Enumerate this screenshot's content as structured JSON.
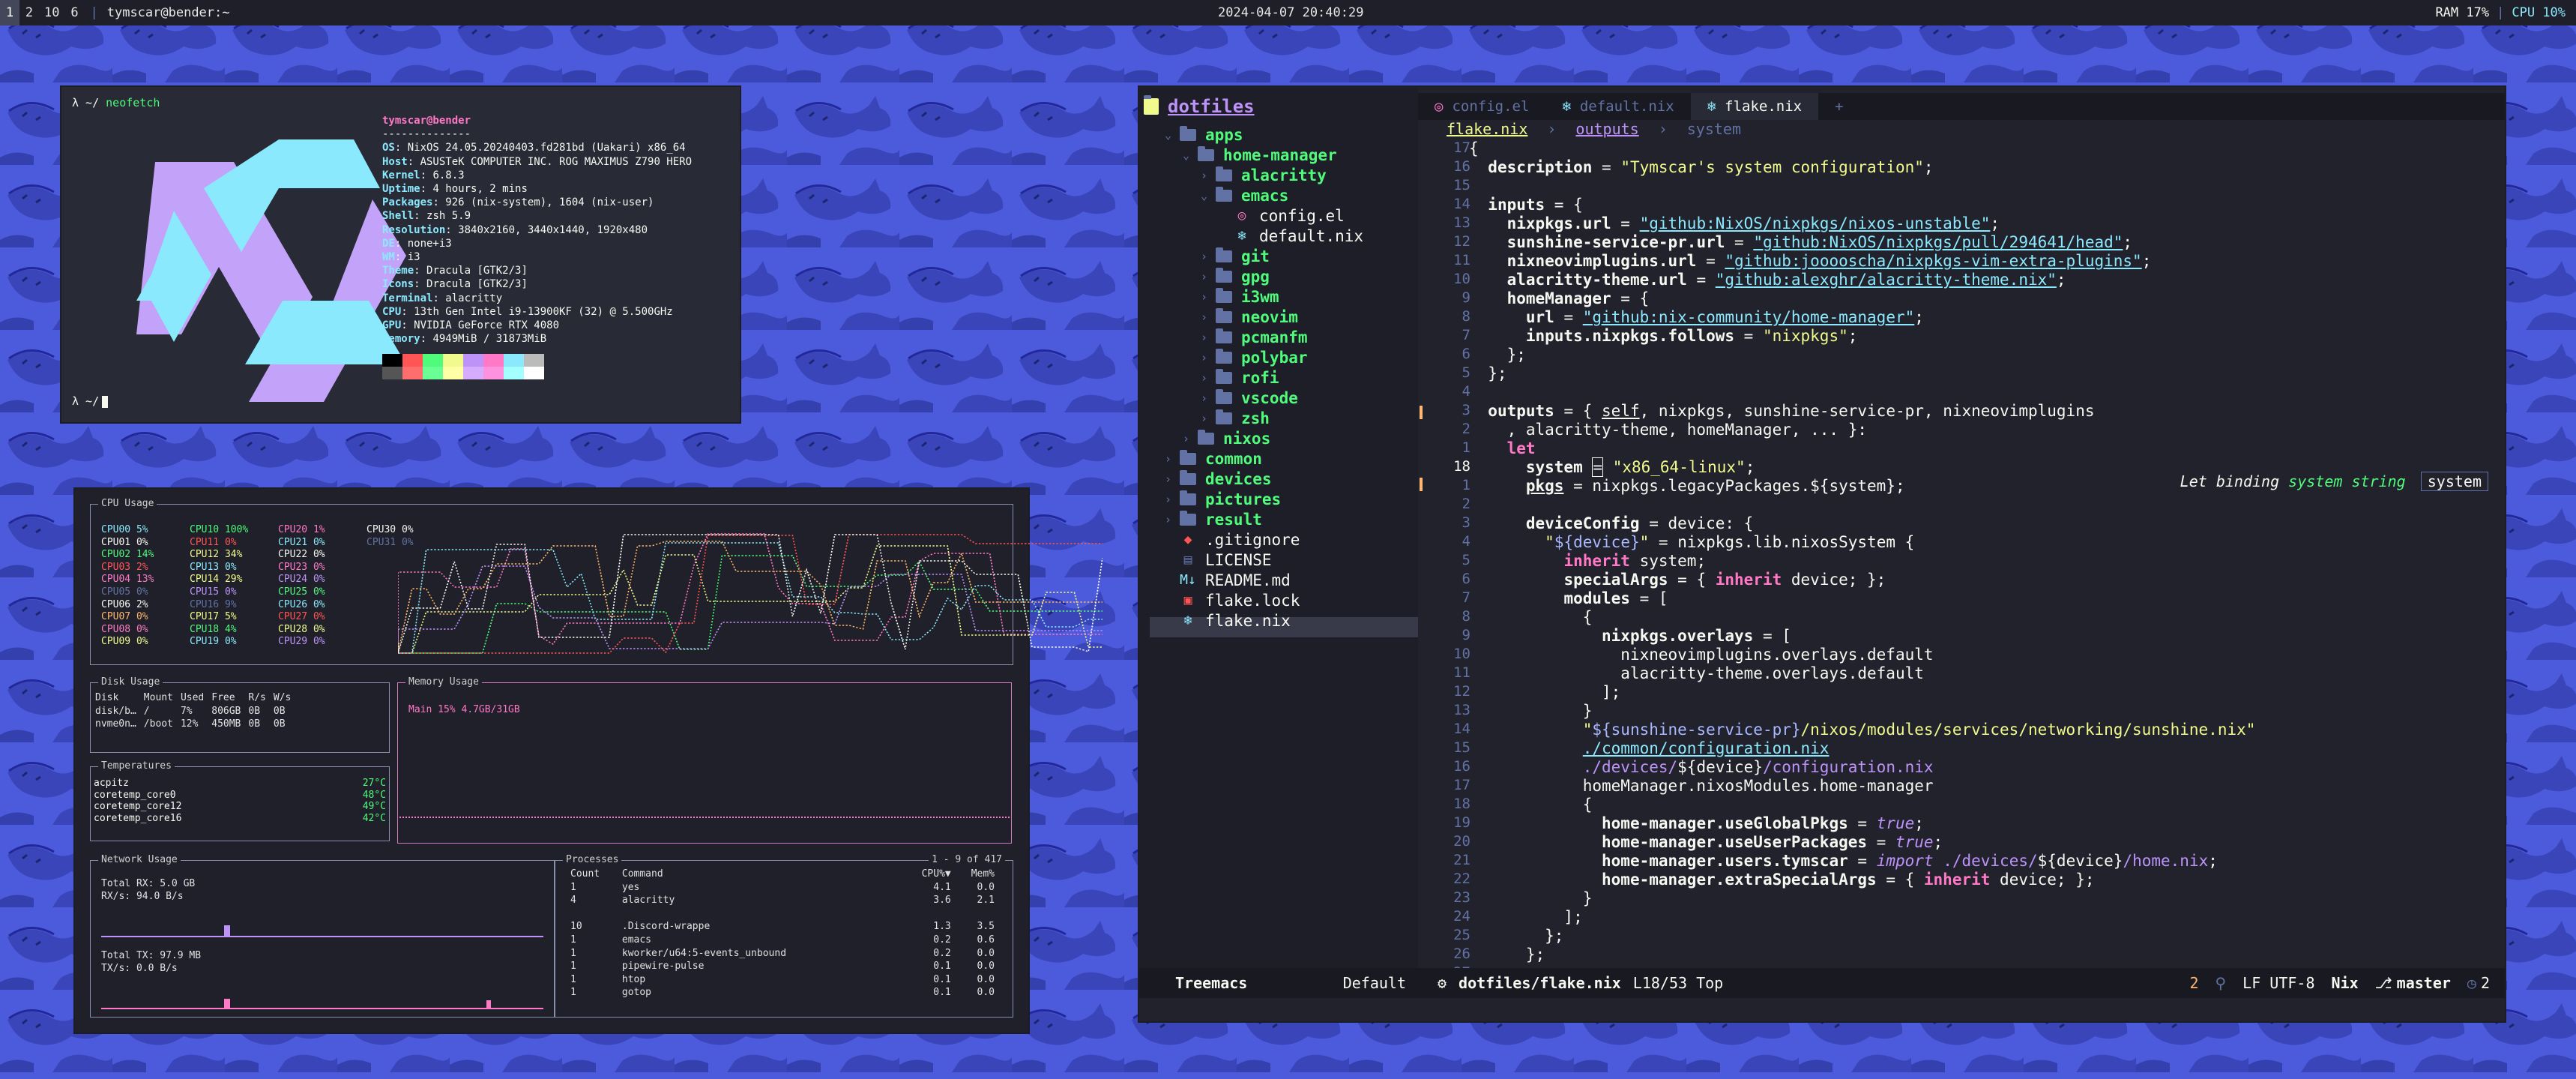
{
  "bar": {
    "workspaces": [
      "1",
      "2",
      "10",
      "6"
    ],
    "title": "tymscar@bender:~",
    "clock": "2024-04-07 20:40:29",
    "ram": "RAM 17%",
    "cpu": "CPU 10%"
  },
  "neofetch": {
    "prompt_symbol": "λ ~/",
    "command": "neofetch",
    "user_host": "tymscar@bender",
    "divider": "--------------",
    "fields": [
      {
        "k": "OS",
        "v": "NixOS 24.05.20240403.fd281bd (Uakari) x86_64"
      },
      {
        "k": "Host",
        "v": "ASUSTeK COMPUTER INC. ROG MAXIMUS Z790 HERO"
      },
      {
        "k": "Kernel",
        "v": "6.8.3"
      },
      {
        "k": "Uptime",
        "v": "4 hours, 2 mins"
      },
      {
        "k": "Packages",
        "v": "926 (nix-system), 1604 (nix-user)"
      },
      {
        "k": "Shell",
        "v": "zsh 5.9"
      },
      {
        "k": "Resolution",
        "v": "3840x2160, 3440x1440, 1920x480"
      },
      {
        "k": "DE",
        "v": "none+i3"
      },
      {
        "k": "WM",
        "v": "i3"
      },
      {
        "k": "Theme",
        "v": "Dracula [GTK2/3]"
      },
      {
        "k": "Icons",
        "v": "Dracula [GTK2/3]"
      },
      {
        "k": "Terminal",
        "v": "alacritty"
      },
      {
        "k": "CPU",
        "v": "13th Gen Intel i9-13900KF (32) @ 5.500GHz"
      },
      {
        "k": "GPU",
        "v": "NVIDIA GeForce RTX 4080"
      },
      {
        "k": "Memory",
        "v": "4949MiB / 31873MiB"
      }
    ],
    "colors_top": [
      "#000000",
      "#ff5555",
      "#50fa7b",
      "#f1fa8c",
      "#bd93f9",
      "#ff79c6",
      "#8be9fd",
      "#bbbbbb"
    ],
    "colors_bottom": [
      "#555555",
      "#ff6e6e",
      "#69ff94",
      "#ffffa5",
      "#d6acff",
      "#ff92df",
      "#a4ffff",
      "#ffffff"
    ],
    "logo_colors": [
      "#c3a3fa",
      "#8be9fd"
    ]
  },
  "btop": {
    "cpu_label": "CPU Usage",
    "cpu_rows": [
      [
        {
          "n": "CPU00",
          "v": "5%",
          "c": "#8be9fd"
        },
        {
          "n": "CPU10",
          "v": "100%",
          "c": "#50fa7b"
        },
        {
          "n": "CPU20",
          "v": "1%",
          "c": "#ff79c6"
        },
        {
          "n": "CPU30",
          "v": "0%",
          "c": "#f8f8f2"
        }
      ],
      [
        {
          "n": "CPU01",
          "v": "0%",
          "c": "#f8f8f2"
        },
        {
          "n": "CPU11",
          "v": "0%",
          "c": "#ff5555"
        },
        {
          "n": "CPU21",
          "v": "0%",
          "c": "#8be9fd"
        },
        {
          "n": "CPU31",
          "v": "0%",
          "c": "#6272a4"
        }
      ],
      [
        {
          "n": "CPU02",
          "v": "14%",
          "c": "#50fa7b"
        },
        {
          "n": "CPU12",
          "v": "34%",
          "c": "#f1fa8c"
        },
        {
          "n": "CPU22",
          "v": "0%",
          "c": "#f8f8f2"
        }
      ],
      [
        {
          "n": "CPU03",
          "v": "2%",
          "c": "#ff5555"
        },
        {
          "n": "CPU13",
          "v": "0%",
          "c": "#8be9fd"
        },
        {
          "n": "CPU23",
          "v": "0%",
          "c": "#ff79c6"
        }
      ],
      [
        {
          "n": "CPU04",
          "v": "13%",
          "c": "#ff79c6"
        },
        {
          "n": "CPU14",
          "v": "29%",
          "c": "#f1fa8c"
        },
        {
          "n": "CPU24",
          "v": "0%",
          "c": "#bd93f9"
        }
      ],
      [
        {
          "n": "CPU05",
          "v": "0%",
          "c": "#6272a4"
        },
        {
          "n": "CPU15",
          "v": "0%",
          "c": "#bd93f9"
        },
        {
          "n": "CPU25",
          "v": "0%",
          "c": "#50fa7b"
        }
      ],
      [
        {
          "n": "CPU06",
          "v": "2%",
          "c": "#f8f8f2"
        },
        {
          "n": "CPU16",
          "v": "9%",
          "c": "#6272a4"
        },
        {
          "n": "CPU26",
          "v": "0%",
          "c": "#8be9fd"
        }
      ],
      [
        {
          "n": "CPU07",
          "v": "0%",
          "c": "#ffb86c"
        },
        {
          "n": "CPU17",
          "v": "5%",
          "c": "#f1fa8c"
        },
        {
          "n": "CPU27",
          "v": "0%",
          "c": "#ff5555"
        }
      ],
      [
        {
          "n": "CPU08",
          "v": "0%",
          "c": "#ff79c6"
        },
        {
          "n": "CPU18",
          "v": "4%",
          "c": "#50fa7b"
        },
        {
          "n": "CPU28",
          "v": "0%",
          "c": "#f1fa8c"
        }
      ],
      [
        {
          "n": "CPU09",
          "v": "0%",
          "c": "#f1fa8c"
        },
        {
          "n": "CPU19",
          "v": "0%",
          "c": "#8be9fd"
        },
        {
          "n": "CPU29",
          "v": "0%",
          "c": "#bd93f9"
        }
      ]
    ],
    "disk": {
      "label": "Disk Usage",
      "headers": [
        "Disk",
        "Mount",
        "Used",
        "Free",
        "R/s",
        "W/s"
      ],
      "rows": [
        [
          "disk/b…",
          "/",
          "7%",
          "806GB",
          "0B",
          "0B"
        ],
        [
          "nvme0n…",
          "/boot",
          "12%",
          "450MB",
          "0B",
          "0B"
        ]
      ]
    },
    "memory": {
      "label": "Memory Usage",
      "line": "Main  15%   4.7GB/31GB"
    },
    "temps": {
      "label": "Temperatures",
      "rows": [
        [
          "acpitz",
          "27°C"
        ],
        [
          "coretemp_core0",
          "48°C"
        ],
        [
          "coretemp_core12",
          "49°C"
        ],
        [
          "coretemp_core16",
          "42°C"
        ]
      ]
    },
    "network": {
      "label": "Network Usage",
      "rx": [
        "Total RX:   5.0 GB",
        "RX/s:     94.0  B/s"
      ],
      "tx": [
        "Total TX:  97.9 MB",
        "TX/s:      0.0  B/s"
      ]
    },
    "processes": {
      "label": "Processes",
      "range": "1 - 9 of 417",
      "headers": [
        "Count",
        "Command",
        "CPU%▼",
        "Mem%"
      ],
      "rows": [
        [
          "1",
          "yes",
          "4.1",
          "0.0"
        ],
        [
          "4",
          "alacritty",
          "3.6",
          "2.1"
        ],
        [
          "",
          "",
          "",
          ""
        ],
        [
          "10",
          ".Discord-wrappe",
          "1.3",
          "3.5"
        ],
        [
          "1",
          "emacs",
          "0.2",
          "0.6"
        ],
        [
          "1",
          "kworker/u64:5-events_unbound",
          "0.2",
          "0.0"
        ],
        [
          "1",
          "pipewire-pulse",
          "0.1",
          "0.0"
        ],
        [
          "1",
          "htop",
          "0.1",
          "0.0"
        ],
        [
          "1",
          "gotop",
          "0.1",
          "0.0"
        ]
      ]
    }
  },
  "emacs": {
    "tree_root": "dotfiles",
    "tree": [
      {
        "indent": 1,
        "type": "dir",
        "open": true,
        "name": "apps",
        "icon": ""
      },
      {
        "indent": 2,
        "type": "dir",
        "open": true,
        "name": "home-manager",
        "icon": ""
      },
      {
        "indent": 3,
        "type": "dir",
        "open": false,
        "name": "alacritty",
        "icon": ""
      },
      {
        "indent": 3,
        "type": "dir",
        "open": true,
        "name": "emacs",
        "icon": ""
      },
      {
        "indent": 4,
        "type": "file",
        "name": "config.el",
        "icon": "◎",
        "color": "#ff79c6"
      },
      {
        "indent": 4,
        "type": "file",
        "name": "default.nix",
        "icon": "❄",
        "color": "#8be9fd"
      },
      {
        "indent": 3,
        "type": "dir",
        "open": false,
        "name": "git",
        "icon": ""
      },
      {
        "indent": 3,
        "type": "dir",
        "open": false,
        "name": "gpg",
        "icon": ""
      },
      {
        "indent": 3,
        "type": "dir",
        "open": false,
        "name": "i3wm",
        "icon": ""
      },
      {
        "indent": 3,
        "type": "dir",
        "open": false,
        "name": "neovim",
        "icon": ""
      },
      {
        "indent": 3,
        "type": "dir",
        "open": false,
        "name": "pcmanfm",
        "icon": ""
      },
      {
        "indent": 3,
        "type": "dir",
        "open": false,
        "name": "polybar",
        "icon": ""
      },
      {
        "indent": 3,
        "type": "dir",
        "open": false,
        "name": "rofi",
        "icon": ""
      },
      {
        "indent": 3,
        "type": "dir",
        "open": false,
        "name": "vscode",
        "icon": ""
      },
      {
        "indent": 3,
        "type": "dir",
        "open": false,
        "name": "zsh",
        "icon": ""
      },
      {
        "indent": 2,
        "type": "dir",
        "open": false,
        "name": "nixos",
        "icon": ""
      },
      {
        "indent": 1,
        "type": "dir",
        "open": false,
        "name": "common",
        "icon": ""
      },
      {
        "indent": 1,
        "type": "dir",
        "open": false,
        "name": "devices",
        "icon": ""
      },
      {
        "indent": 1,
        "type": "dir",
        "open": false,
        "name": "pictures",
        "icon": ""
      },
      {
        "indent": 1,
        "type": "dir",
        "open": false,
        "name": "result",
        "icon": ""
      },
      {
        "indent": 1,
        "type": "file",
        "name": ".gitignore",
        "icon": "◆",
        "color": "#ff5555"
      },
      {
        "indent": 1,
        "type": "file",
        "name": "LICENSE",
        "icon": "▤",
        "color": "#6272a4"
      },
      {
        "indent": 1,
        "type": "file",
        "name": "README.md",
        "icon": "M↓",
        "color": "#8be9fd"
      },
      {
        "indent": 1,
        "type": "file",
        "name": "flake.lock",
        "icon": "▣",
        "color": "#ff5555"
      },
      {
        "indent": 1,
        "type": "file",
        "name": "flake.nix",
        "icon": "❄",
        "color": "#8be9fd"
      }
    ],
    "tabs": [
      {
        "name": "config.el",
        "icon": "◎",
        "active": false
      },
      {
        "name": "default.nix",
        "icon": "❄",
        "active": false
      },
      {
        "name": "flake.nix",
        "icon": "❄",
        "active": true
      },
      {
        "name": "+",
        "icon": "",
        "active": false
      }
    ],
    "crumbs": [
      "flake.nix",
      "outputs",
      "system"
    ],
    "line_numbers": [
      "17",
      "16",
      "15",
      "14",
      "13",
      "12",
      "11",
      "10",
      "9",
      "8",
      "7",
      "6",
      "5",
      "4",
      "3",
      "2",
      "1",
      "18",
      "1",
      "2",
      "3",
      "4",
      "5",
      "6",
      "7",
      "8",
      "9",
      "10",
      "11",
      "12",
      "13",
      "14",
      "15",
      "16",
      "17",
      "18",
      "19",
      "20",
      "21",
      "22",
      "23",
      "24",
      "25",
      "26",
      "27"
    ],
    "lens": {
      "label": "Let binding",
      "name": "system string",
      "box": "system"
    },
    "modeline": {
      "left": "Treemacs",
      "left_mode": "Default",
      "file": "dotfiles/flake.nix",
      "pos": "L18/53 Top",
      "warnings": "2",
      "encoding": "LF UTF-8",
      "mode": "Nix",
      "branch": "master",
      "errors": "2"
    }
  }
}
